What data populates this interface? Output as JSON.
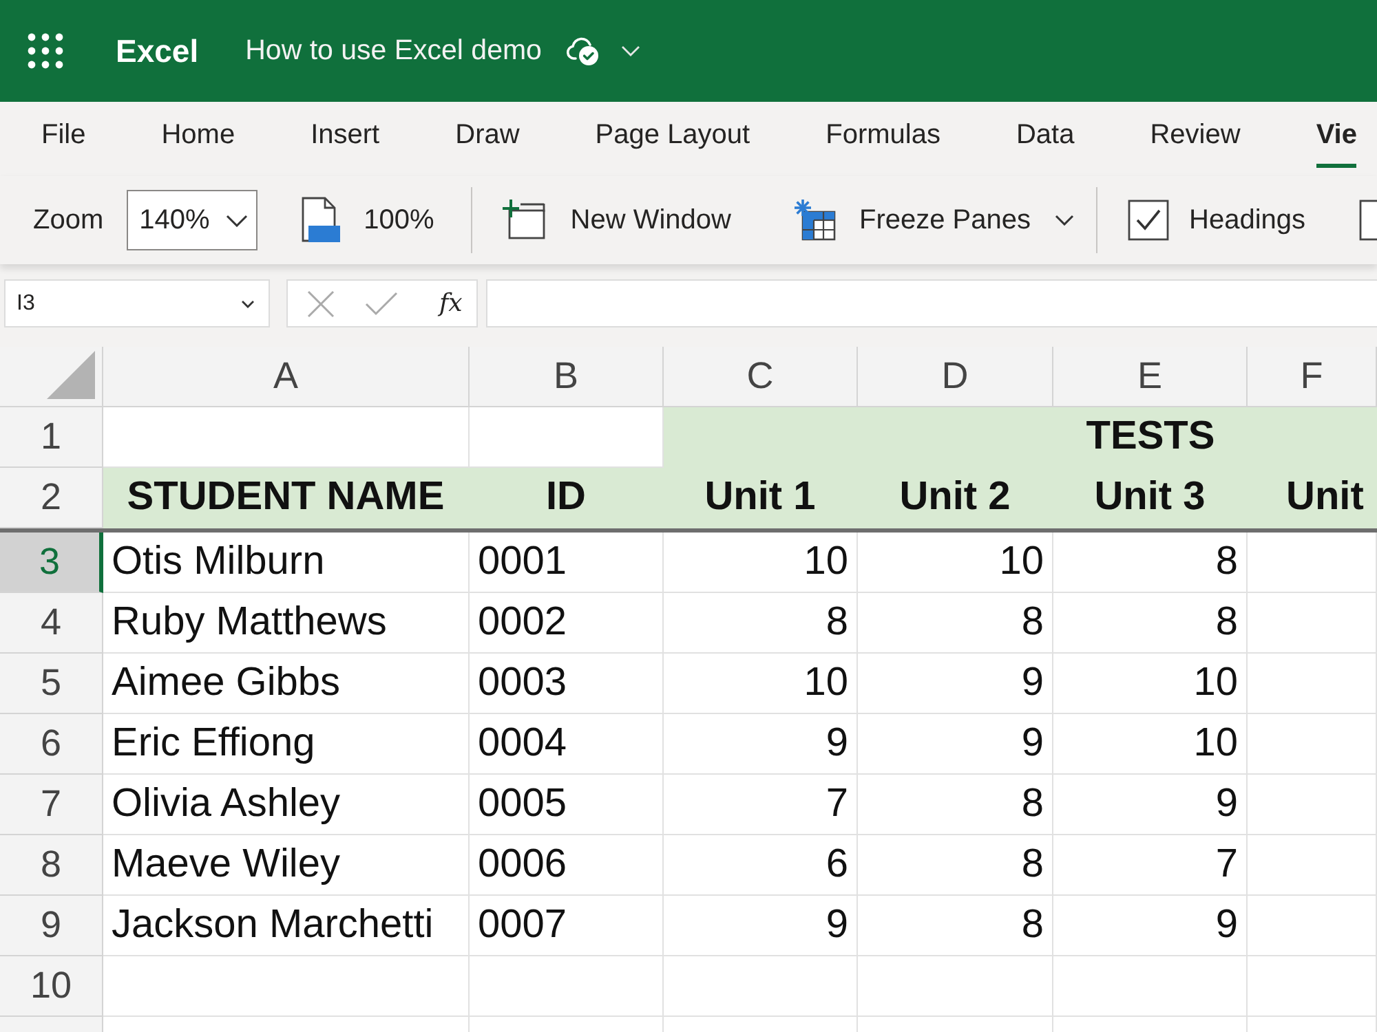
{
  "app_bar": {
    "app_name": "Excel",
    "document_title": "How to use Excel demo"
  },
  "ribbon_tabs": [
    {
      "label": "File",
      "selected": false
    },
    {
      "label": "Home",
      "selected": false
    },
    {
      "label": "Insert",
      "selected": false
    },
    {
      "label": "Draw",
      "selected": false
    },
    {
      "label": "Page Layout",
      "selected": false
    },
    {
      "label": "Formulas",
      "selected": false
    },
    {
      "label": "Data",
      "selected": false
    },
    {
      "label": "Review",
      "selected": false
    },
    {
      "label": "Vie",
      "selected": true
    }
  ],
  "view_toolbar": {
    "zoom_label": "Zoom",
    "zoom_value": "140%",
    "zoom_100_button": "100%",
    "new_window_button": "New Window",
    "freeze_panes_button": "Freeze Panes",
    "headings_checkbox": {
      "label": "Headings",
      "checked": true
    },
    "next_checkbox": {
      "checked": false
    }
  },
  "formula_bar": {
    "name_box": "I3",
    "function_label": "fx"
  },
  "sheet": {
    "columns": [
      {
        "label": "A",
        "selected": false
      },
      {
        "label": "B",
        "selected": false
      },
      {
        "label": "C",
        "selected": false
      },
      {
        "label": "D",
        "selected": false
      },
      {
        "label": "E",
        "selected": false
      },
      {
        "label": "F",
        "selected": false
      }
    ],
    "rows": [
      {
        "number": "1",
        "selected": false,
        "freeze_line_below": false,
        "cells": [
          {
            "kind": "blank"
          },
          {
            "kind": "blank"
          },
          {
            "kind": "merged",
            "text": "TESTS",
            "color": "#d9ead3"
          }
        ]
      },
      {
        "number": "2",
        "selected": false,
        "freeze_line_below": true,
        "cells": [
          {
            "kind": "header",
            "text": "STUDENT NAME",
            "color": "#d9ead3"
          },
          {
            "kind": "header",
            "text": "ID",
            "color": "#d9ead3"
          },
          {
            "kind": "header",
            "text": "Unit 1",
            "color": "#d9ead3"
          },
          {
            "kind": "header",
            "text": "Unit 2",
            "color": "#d9ead3"
          },
          {
            "kind": "header",
            "text": "Unit 3",
            "color": "#d9ead3"
          },
          {
            "kind": "header",
            "text": "Unit",
            "color": "#d9ead3"
          }
        ]
      },
      {
        "number": "3",
        "selected": true,
        "freeze_line_below": false,
        "cells": [
          {
            "kind": "text",
            "text": "Otis Milburn"
          },
          {
            "kind": "text",
            "text": "0001"
          },
          {
            "kind": "number",
            "text": "10"
          },
          {
            "kind": "number",
            "text": "10"
          },
          {
            "kind": "number",
            "text": "8"
          },
          {
            "kind": "blank"
          }
        ]
      },
      {
        "number": "4",
        "selected": false,
        "freeze_line_below": false,
        "cells": [
          {
            "kind": "text",
            "text": "Ruby Matthews"
          },
          {
            "kind": "text",
            "text": "0002"
          },
          {
            "kind": "number",
            "text": "8"
          },
          {
            "kind": "number",
            "text": "8"
          },
          {
            "kind": "number",
            "text": "8"
          },
          {
            "kind": "blank"
          }
        ]
      },
      {
        "number": "5",
        "selected": false,
        "freeze_line_below": false,
        "cells": [
          {
            "kind": "text",
            "text": "Aimee Gibbs"
          },
          {
            "kind": "text",
            "text": "0003"
          },
          {
            "kind": "number",
            "text": "10"
          },
          {
            "kind": "number",
            "text": "9"
          },
          {
            "kind": "number",
            "text": "10"
          },
          {
            "kind": "blank"
          }
        ]
      },
      {
        "number": "6",
        "selected": false,
        "freeze_line_below": false,
        "cells": [
          {
            "kind": "text",
            "text": "Eric Effiong"
          },
          {
            "kind": "text",
            "text": "0004"
          },
          {
            "kind": "number",
            "text": "9"
          },
          {
            "kind": "number",
            "text": "9"
          },
          {
            "kind": "number",
            "text": "10"
          },
          {
            "kind": "blank"
          }
        ]
      },
      {
        "number": "7",
        "selected": false,
        "freeze_line_below": false,
        "cells": [
          {
            "kind": "text",
            "text": "Olivia Ashley"
          },
          {
            "kind": "text",
            "text": "0005"
          },
          {
            "kind": "number",
            "text": "7"
          },
          {
            "kind": "number",
            "text": "8"
          },
          {
            "kind": "number",
            "text": "9"
          },
          {
            "kind": "blank"
          }
        ]
      },
      {
        "number": "8",
        "selected": false,
        "freeze_line_below": false,
        "cells": [
          {
            "kind": "text",
            "text": "Maeve Wiley"
          },
          {
            "kind": "text",
            "text": "0006"
          },
          {
            "kind": "number",
            "text": "6"
          },
          {
            "kind": "number",
            "text": "8"
          },
          {
            "kind": "number",
            "text": "7"
          },
          {
            "kind": "blank"
          }
        ]
      },
      {
        "number": "9",
        "selected": false,
        "freeze_line_below": false,
        "cells": [
          {
            "kind": "text",
            "text": "Jackson Marchetti"
          },
          {
            "kind": "text",
            "text": "0007"
          },
          {
            "kind": "number",
            "text": "9"
          },
          {
            "kind": "number",
            "text": "8"
          },
          {
            "kind": "number",
            "text": "9"
          },
          {
            "kind": "blank"
          }
        ]
      },
      {
        "number": "10",
        "selected": false,
        "freeze_line_below": false,
        "cells": [
          {
            "kind": "blank"
          },
          {
            "kind": "blank"
          },
          {
            "kind": "blank"
          },
          {
            "kind": "blank"
          },
          {
            "kind": "blank"
          },
          {
            "kind": "blank"
          }
        ]
      }
    ]
  }
}
